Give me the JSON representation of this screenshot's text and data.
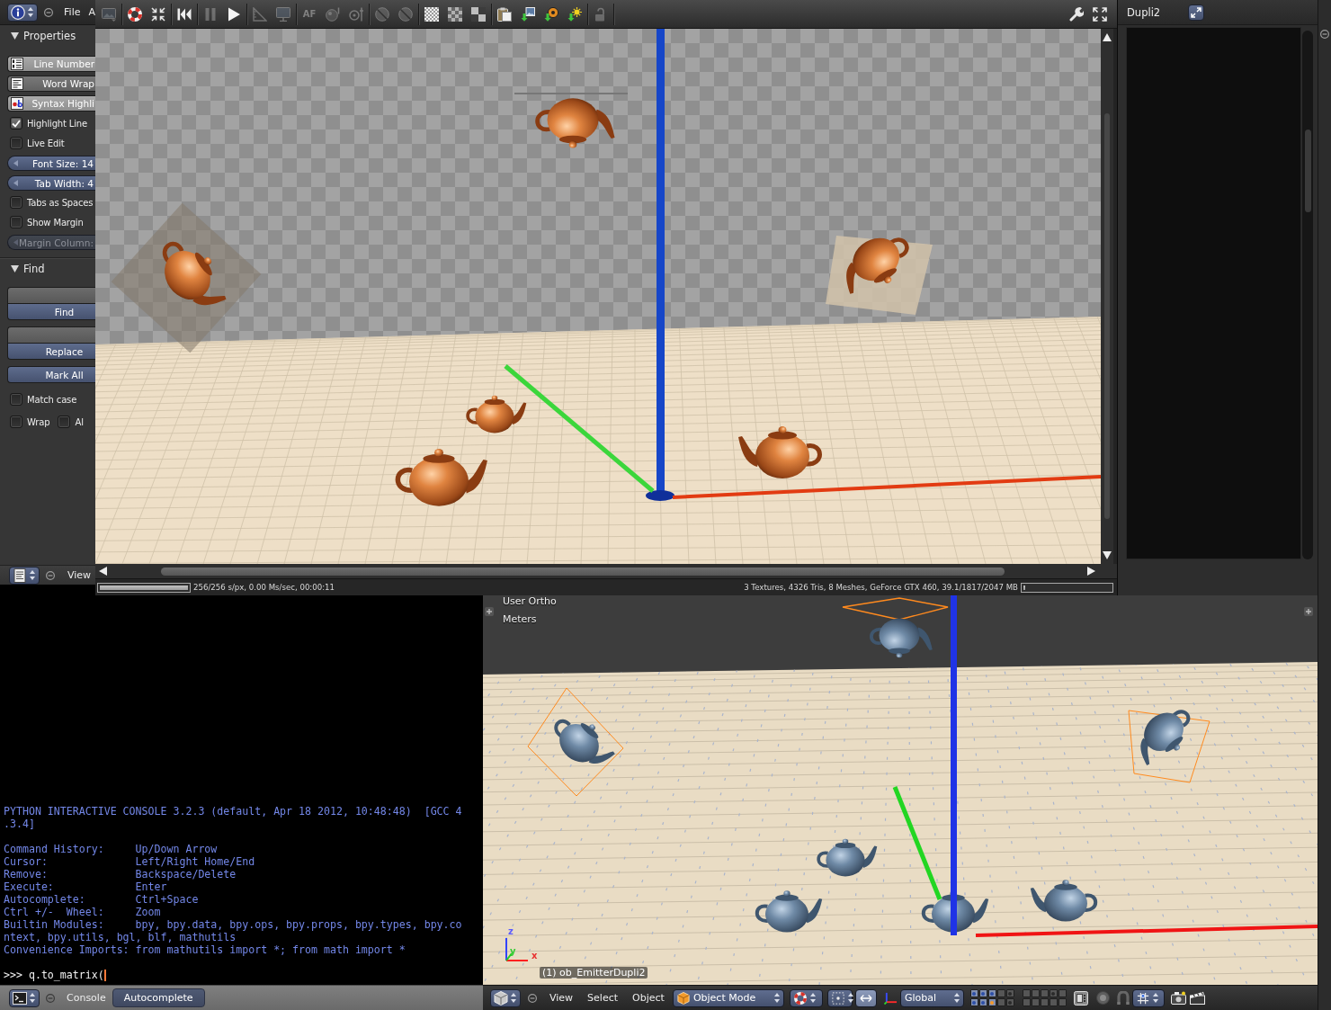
{
  "text_editor": {
    "header": {
      "menus": [
        "File",
        "A"
      ]
    },
    "properties": {
      "title": "Properties",
      "expanded": true,
      "controls": [
        {
          "kind": "toggle",
          "label": "Line Number",
          "on": true
        },
        {
          "kind": "toggle",
          "label": "Word Wrap",
          "on": false
        },
        {
          "kind": "toggle",
          "label": "Syntax Highli",
          "on": true
        },
        {
          "kind": "checkbox",
          "label": "Highlight Line",
          "checked": true
        },
        {
          "kind": "checkbox",
          "label": "Live Edit",
          "checked": false
        },
        {
          "kind": "number",
          "label": "Font Size: 14",
          "disabled": false
        },
        {
          "kind": "number",
          "label": "Tab Width: 4",
          "disabled": false
        },
        {
          "kind": "checkbox",
          "label": "Tabs as Spaces",
          "checked": false
        },
        {
          "kind": "checkbox",
          "label": "Show Margin",
          "checked": false
        },
        {
          "kind": "number",
          "label": "Margin Column:",
          "disabled": true
        }
      ]
    },
    "find": {
      "title": "Find",
      "expanded": true,
      "actions": [
        {
          "field": true,
          "label": "Find"
        },
        {
          "field": true,
          "label": "Replace"
        },
        {
          "field": false,
          "label": "Mark All"
        }
      ],
      "options": [
        [
          {
            "label": "Match case",
            "checked": false
          }
        ],
        [
          {
            "label": "Wrap",
            "checked": false
          },
          {
            "label": "Al",
            "checked": false
          }
        ]
      ]
    },
    "footer": {
      "menus": [
        "View"
      ]
    }
  },
  "render_window": {
    "toolbar": [
      {
        "items": [
          {
            "kind": "image",
            "disabled": true
          }
        ]
      },
      {
        "items": [
          {
            "kind": "render",
            "disabled": false
          },
          {
            "kind": "shrink",
            "disabled": false
          }
        ]
      },
      {
        "items": [
          {
            "kind": "rewind",
            "disabled": false
          }
        ]
      },
      {
        "items": [
          {
            "kind": "pause",
            "disabled": true
          },
          {
            "kind": "play",
            "disabled": false
          }
        ]
      },
      {
        "items": [
          {
            "kind": "ruler",
            "disabled": true
          },
          {
            "kind": "monitor",
            "disabled": true
          }
        ]
      },
      {
        "items": [
          {
            "kind": "text",
            "label": "AF",
            "disabled": true
          },
          {
            "kind": "orb",
            "disabled": true
          },
          {
            "kind": "pin",
            "disabled": true
          }
        ]
      },
      {
        "items": [
          {
            "kind": "sphere",
            "disabled": true
          },
          {
            "kind": "sphere",
            "disabled": true
          }
        ]
      },
      {
        "items": [
          {
            "kind": "checker_fine",
            "disabled": false
          },
          {
            "kind": "checker",
            "disabled": false
          },
          {
            "kind": "checker_big",
            "disabled": false
          }
        ]
      },
      {
        "items": [
          {
            "kind": "clipboard",
            "disabled": false
          },
          {
            "kind": "load_image",
            "disabled": false
          },
          {
            "kind": "load_render",
            "disabled": false
          },
          {
            "kind": "load_light",
            "disabled": false
          }
        ]
      },
      {
        "items": [
          {
            "kind": "lock",
            "disabled": true
          }
        ]
      }
    ],
    "tools": [
      {
        "kind": "wrench"
      },
      {
        "kind": "fullscreen"
      }
    ],
    "status": {
      "progress": {
        "level": 1
      },
      "text": "256/256 s/px, 0.00 Ms/sec, 00:00:11",
      "stats": "3 Textures, 4326 Tris, 8 Meshes, GeForce GTX 460, 39.1/1817/2047 MB",
      "memory": {
        "level": 0.02
      }
    }
  },
  "right_panel": {
    "header": {
      "title": "Dupli2"
    }
  },
  "console": {
    "banner": [
      "PYTHON INTERACTIVE CONSOLE 3.2.3 (default, Apr 18 2012, 10:48:48)  [GCC 4",
      ".3.4]"
    ],
    "help": [
      "Command History:     Up/Down Arrow",
      "Cursor:              Left/Right Home/End",
      "Remove:              Backspace/Delete",
      "Execute:             Enter",
      "Autocomplete:        Ctrl+Space",
      "Ctrl +/-  Wheel:     Zoom",
      "Builtin Modules:     bpy, bpy.data, bpy.ops, bpy.props, bpy.types, bpy.co",
      "ntext, bpy.utils, bgl, blf, mathutils",
      "Convenience Imports: from mathutils import *; from math import *"
    ],
    "prompt": ">>> q.to_matrix(",
    "header": {
      "menus": [
        "Console"
      ],
      "buttons": [
        "Autocomplete"
      ]
    }
  },
  "viewport": {
    "view": "User Ortho",
    "units": "Meters",
    "axes": [
      {
        "label": "z",
        "color": "#5a5aff"
      },
      {
        "label": "y",
        "color": "#33cc33"
      },
      {
        "label": "x",
        "color": "#e83030"
      }
    ],
    "object": "(1) ob_EmitterDupli2",
    "header": {
      "menus": [
        "View",
        "Select",
        "Object"
      ],
      "mode": "Object Mode",
      "transform_widget": {
        "on": true
      },
      "orientation": "Global",
      "layers": [
        {
          "selected": true,
          "used": true,
          "active": false
        },
        {
          "selected": true,
          "used": true,
          "active": false
        },
        {
          "selected": true,
          "used": true,
          "active": false
        },
        {
          "selected": false,
          "used": false,
          "active": false
        },
        {
          "selected": false,
          "used": true,
          "active": false
        },
        {
          "selected": true,
          "used": true,
          "active": false
        },
        {
          "selected": true,
          "used": true,
          "active": false
        },
        {
          "selected": true,
          "used": true,
          "active": true
        },
        {
          "selected": false,
          "used": false,
          "active": false
        },
        {
          "selected": false,
          "used": true,
          "active": false
        },
        {
          "selected": false,
          "used": false,
          "active": false
        },
        {
          "selected": false,
          "used": false,
          "active": false
        },
        {
          "selected": false,
          "used": false,
          "active": false
        },
        {
          "selected": false,
          "used": true,
          "active": false
        },
        {
          "selected": false,
          "used": false,
          "active": false
        },
        {
          "selected": false,
          "used": false,
          "active": false
        },
        {
          "selected": false,
          "used": false,
          "active": false
        },
        {
          "selected": false,
          "used": false,
          "active": false
        },
        {
          "selected": false,
          "used": false,
          "active": false
        },
        {
          "selected": false,
          "used": false,
          "active": false
        }
      ],
      "snap": {
        "on": false
      }
    }
  }
}
